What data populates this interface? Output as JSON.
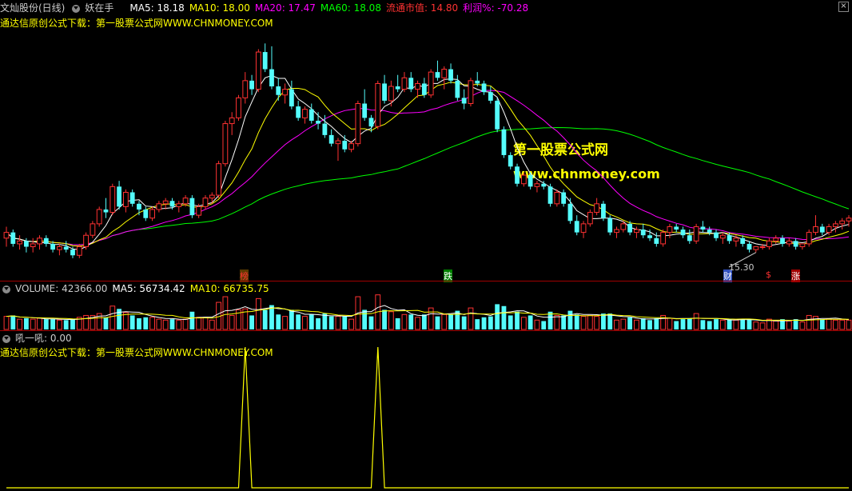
{
  "colors": {
    "up": "#ff3232",
    "down": "#54fcfc",
    "ma5": "#ffffff",
    "ma10": "#ffff00",
    "ma20": "#ff00ff",
    "ma60": "#00ff00",
    "signal": "#ffff00",
    "blue_candle": "#0000ff",
    "vol_ma5": "#ffffff",
    "vol_ma10": "#ffff00",
    "separator": "#a00000"
  },
  "header": {
    "stock_name": "文灿股份(日线)",
    "indicator_name": "妖在手",
    "ma5": "MA5: 18.18",
    "ma10": "MA10: 18.00",
    "ma20": "MA20: 17.47",
    "ma60": "MA60: 18.08",
    "float_cap": "流通市值: 14.80",
    "profit": "利润%: -70.28",
    "close_label": "×"
  },
  "price_subtitle": "通达信原创公式下载：第一股票公式网WWW.CHNMONEY.COM",
  "watermark": {
    "line1": "第一股票公式网",
    "line2": "www.chnmoney.com"
  },
  "markers": {
    "bang": "榜",
    "die": "跌",
    "cai": "财",
    "dollar": "$",
    "zhang": "涨",
    "low_label": "15.30"
  },
  "volume_header": {
    "volume": "VOLUME: 42366.00",
    "ma5": "MA5: 56734.42",
    "ma10": "MA10: 66735.75"
  },
  "signal_header": {
    "name": "吼一吼",
    "value": ": 0.00",
    "subtitle": "通达信原创公式下载：第一股票公式网WWW.CHNMONEY.COM"
  },
  "chart_data": [
    {
      "type": "candlestick",
      "title": "文灿股份(日线)",
      "low_marker": 15.3,
      "ma_legend": {
        "MA5": 18.18,
        "MA10": 18.0,
        "MA20": 17.47,
        "MA60": 18.08
      },
      "candles": [
        [
          15.8,
          16.2,
          15.5,
          16.0
        ],
        [
          16.0,
          16.1,
          15.5,
          15.6
        ],
        [
          15.6,
          15.9,
          15.4,
          15.7
        ],
        [
          15.7,
          15.8,
          15.3,
          15.5
        ],
        [
          15.5,
          15.8,
          15.3,
          15.6
        ],
        [
          15.6,
          15.9,
          15.4,
          15.8
        ],
        [
          15.8,
          15.9,
          15.5,
          15.6
        ],
        [
          15.6,
          15.7,
          15.3,
          15.4
        ],
        [
          15.4,
          15.6,
          15.2,
          15.5
        ],
        [
          15.5,
          15.7,
          15.3,
          15.4
        ],
        [
          15.4,
          15.5,
          15.1,
          15.2
        ],
        [
          15.2,
          15.6,
          15.1,
          15.5
        ],
        [
          15.5,
          16.0,
          15.4,
          15.9
        ],
        [
          15.9,
          16.4,
          15.8,
          16.3
        ],
        [
          16.3,
          16.9,
          16.2,
          16.8
        ],
        [
          16.8,
          17.2,
          16.5,
          16.7
        ],
        [
          16.7,
          17.7,
          16.6,
          17.6
        ],
        [
          17.6,
          17.8,
          16.8,
          16.9
        ],
        [
          16.9,
          17.5,
          16.7,
          17.4
        ],
        [
          17.4,
          17.5,
          16.9,
          17.0
        ],
        [
          17.0,
          17.1,
          16.6,
          16.8
        ],
        [
          16.8,
          16.9,
          16.4,
          16.5
        ],
        [
          16.5,
          16.9,
          16.4,
          16.8
        ],
        [
          16.8,
          17.1,
          16.7,
          17.0
        ],
        [
          17.0,
          17.2,
          16.8,
          17.1
        ],
        [
          17.1,
          17.2,
          16.8,
          16.9
        ],
        [
          16.9,
          17.1,
          16.7,
          17.0
        ],
        [
          17.0,
          17.3,
          16.9,
          17.2
        ],
        [
          17.2,
          17.3,
          16.5,
          16.6
        ],
        [
          16.6,
          17.0,
          16.5,
          16.9
        ],
        [
          16.9,
          17.3,
          16.8,
          17.2
        ],
        [
          17.2,
          17.4,
          17.0,
          17.3
        ],
        [
          17.3,
          18.5,
          17.2,
          18.4
        ],
        [
          18.4,
          19.9,
          18.3,
          19.8
        ],
        [
          19.8,
          20.2,
          19.4,
          20.0
        ],
        [
          20.0,
          20.8,
          19.9,
          20.7
        ],
        [
          20.7,
          21.6,
          20.5,
          21.3
        ],
        [
          21.3,
          21.5,
          20.8,
          21.0
        ],
        [
          21.0,
          22.4,
          20.9,
          22.3
        ],
        [
          22.3,
          22.6,
          21.6,
          21.7
        ],
        [
          21.7,
          22.5,
          21.0,
          21.1
        ],
        [
          21.1,
          21.4,
          20.6,
          20.8
        ],
        [
          20.8,
          21.2,
          20.5,
          21.0
        ],
        [
          21.0,
          21.3,
          20.3,
          20.4
        ],
        [
          20.4,
          20.6,
          19.9,
          20.0
        ],
        [
          20.0,
          20.4,
          19.8,
          20.3
        ],
        [
          20.3,
          20.5,
          19.8,
          19.9
        ],
        [
          19.9,
          20.2,
          19.6,
          19.8
        ],
        [
          19.8,
          20.1,
          19.3,
          19.4
        ],
        [
          19.4,
          19.6,
          19.0,
          19.1
        ],
        [
          19.1,
          19.3,
          18.5,
          19.2
        ],
        [
          19.2,
          19.4,
          18.8,
          18.9
        ],
        [
          18.9,
          19.2,
          18.8,
          19.1
        ],
        [
          19.1,
          20.6,
          19.0,
          20.5
        ],
        [
          20.5,
          21.0,
          19.9,
          20.0
        ],
        [
          20.0,
          20.1,
          19.5,
          19.7
        ],
        [
          19.7,
          21.3,
          19.6,
          21.2
        ],
        [
          21.2,
          21.5,
          20.5,
          20.6
        ],
        [
          20.6,
          21.3,
          20.4,
          21.1
        ],
        [
          21.1,
          21.5,
          20.9,
          21.0
        ],
        [
          21.0,
          21.6,
          20.9,
          21.4
        ],
        [
          21.4,
          21.6,
          20.9,
          21.0
        ],
        [
          21.0,
          21.3,
          20.7,
          21.2
        ],
        [
          21.2,
          21.4,
          20.7,
          20.8
        ],
        [
          20.8,
          21.7,
          20.7,
          21.6
        ],
        [
          21.6,
          22.0,
          21.3,
          21.4
        ],
        [
          21.4,
          21.8,
          21.0,
          21.7
        ],
        [
          21.7,
          21.9,
          21.2,
          21.3
        ],
        [
          21.3,
          21.5,
          20.6,
          20.7
        ],
        [
          20.7,
          21.0,
          20.3,
          20.5
        ],
        [
          20.5,
          21.4,
          20.4,
          21.3
        ],
        [
          21.3,
          21.6,
          21.1,
          21.2
        ],
        [
          21.2,
          21.3,
          20.8,
          20.9
        ],
        [
          20.9,
          21.1,
          20.5,
          20.6
        ],
        [
          20.6,
          20.7,
          19.5,
          19.6
        ],
        [
          19.6,
          19.7,
          18.6,
          18.7
        ],
        [
          18.7,
          18.8,
          18.2,
          18.3
        ],
        [
          18.3,
          18.4,
          17.6,
          17.7
        ],
        [
          17.7,
          18.1,
          17.6,
          18.0
        ],
        [
          18.0,
          18.1,
          17.5,
          17.6
        ],
        [
          17.6,
          17.8,
          17.4,
          17.7
        ],
        [
          17.7,
          17.8,
          17.5,
          17.6
        ],
        [
          17.6,
          17.7,
          16.9,
          17.0
        ],
        [
          17.0,
          17.5,
          16.9,
          17.4
        ],
        [
          17.4,
          17.5,
          16.9,
          17.0
        ],
        [
          17.0,
          17.2,
          16.3,
          16.4
        ],
        [
          16.4,
          16.6,
          15.9,
          16.0
        ],
        [
          16.0,
          16.4,
          15.8,
          16.3
        ],
        [
          16.3,
          16.8,
          16.2,
          16.7
        ],
        [
          16.7,
          17.2,
          16.6,
          17.0
        ],
        [
          17.0,
          17.1,
          16.4,
          16.5
        ],
        [
          16.5,
          16.6,
          15.9,
          16.0
        ],
        [
          16.0,
          16.2,
          15.8,
          16.1
        ],
        [
          16.1,
          16.4,
          16.0,
          16.3
        ],
        [
          16.3,
          16.4,
          15.9,
          16.0
        ],
        [
          16.0,
          16.2,
          15.8,
          16.1
        ],
        [
          16.1,
          16.3,
          15.8,
          15.9
        ],
        [
          15.9,
          16.1,
          15.7,
          15.8
        ],
        [
          15.8,
          16.0,
          15.5,
          15.6
        ],
        [
          15.6,
          16.1,
          15.5,
          16.0
        ],
        [
          16.0,
          16.3,
          15.8,
          16.2
        ],
        [
          16.2,
          16.3,
          16.0,
          16.1
        ],
        [
          16.1,
          16.2,
          15.8,
          15.9
        ],
        [
          15.9,
          16.1,
          15.6,
          15.7
        ],
        [
          15.7,
          16.3,
          15.6,
          16.2
        ],
        [
          16.2,
          16.4,
          16.0,
          16.1
        ],
        [
          16.1,
          16.2,
          15.9,
          16.0
        ],
        [
          16.0,
          16.1,
          15.7,
          15.8
        ],
        [
          15.8,
          16.0,
          15.6,
          15.9
        ],
        [
          15.9,
          16.0,
          15.6,
          15.7
        ],
        [
          15.7,
          15.9,
          15.5,
          15.8
        ],
        [
          15.8,
          15.9,
          15.5,
          15.6
        ],
        [
          15.6,
          15.7,
          15.3,
          15.4
        ],
        [
          15.4,
          15.5,
          15.3,
          15.5
        ],
        [
          15.5,
          15.6,
          15.4,
          15.5
        ],
        [
          15.5,
          15.8,
          15.4,
          15.7
        ],
        [
          15.7,
          15.9,
          15.6,
          15.8
        ],
        [
          15.8,
          15.9,
          15.5,
          15.6
        ],
        [
          15.6,
          15.8,
          15.5,
          15.7
        ],
        [
          15.7,
          15.8,
          15.4,
          15.5
        ],
        [
          15.5,
          15.6,
          15.4,
          15.6
        ],
        [
          15.6,
          16.1,
          15.5,
          16.0
        ],
        [
          16.0,
          16.6,
          15.9,
          16.2
        ],
        [
          16.2,
          16.3,
          15.9,
          16.0
        ],
        [
          16.0,
          16.3,
          15.9,
          16.2
        ],
        [
          16.2,
          16.4,
          16.0,
          16.3
        ],
        [
          16.3,
          16.5,
          16.1,
          16.4
        ],
        [
          16.4,
          16.6,
          16.2,
          16.5
        ]
      ]
    },
    {
      "type": "bar",
      "title": "VOLUME",
      "volume_latest": 42366.0,
      "volume_ma5": 56734.42,
      "volume_ma10": 66735.75,
      "ylim": [
        0,
        200000
      ]
    },
    {
      "type": "line",
      "title": "吼一吼",
      "latest_value": 0.0,
      "spikes_at_index": [
        36,
        56
      ],
      "ylim": [
        0,
        1
      ]
    }
  ]
}
